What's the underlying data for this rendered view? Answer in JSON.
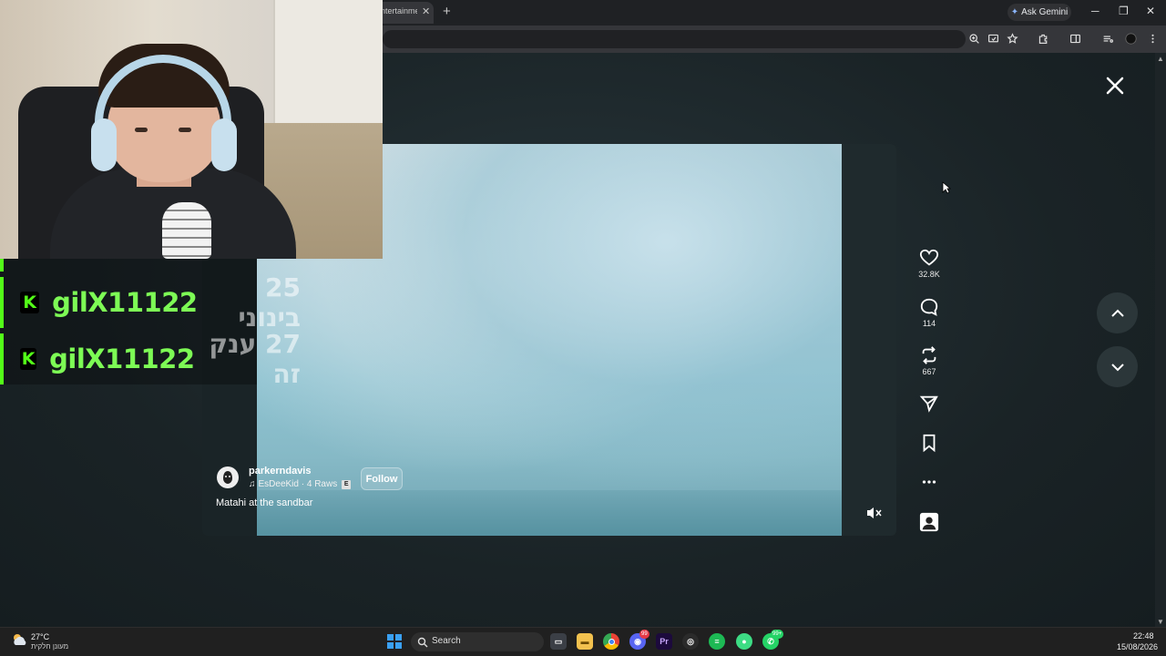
{
  "browser": {
    "tab_title": "ntertainme",
    "tab_close": "✕",
    "new_tab": "+",
    "gemini_label": "Ask Gemini",
    "window_controls": [
      "─",
      "❐",
      "✕"
    ]
  },
  "post": {
    "creator": "parkerndavis",
    "sound": "EsDeeKid · 4 Raws",
    "explicit_badge": "E",
    "follow_label": "Follow",
    "caption": "Matahi at the sandbar",
    "likes": "32.8K",
    "comments": "114",
    "reposts": "667"
  },
  "stream_chat": {
    "messages": [
      {
        "user": "gilX11122",
        "text": "25 בינוני"
      },
      {
        "user": "gilX11122",
        "text": "27 ענק זה"
      }
    ],
    "badge_letter": "K"
  },
  "taskbar": {
    "weather_temp": "27°C",
    "weather_desc": "מעונן חלקית",
    "search_label": "Search",
    "discord_badge": "99",
    "whatsapp_badge": "99+",
    "premiere_label": "Pr",
    "time": "22:48",
    "date": "15/08/2026"
  },
  "colors": {
    "kick_green": "#53fc18",
    "viewer_bg": "#1b2528",
    "taskbar_bg": "#202020"
  },
  "icons": [
    "heart-icon",
    "comment-icon",
    "repost-icon",
    "share-icon",
    "bookmark-icon",
    "more-icon",
    "profile-icon",
    "close-icon",
    "chevron-up-icon",
    "chevron-down-icon",
    "mute-icon",
    "music-note-icon"
  ]
}
